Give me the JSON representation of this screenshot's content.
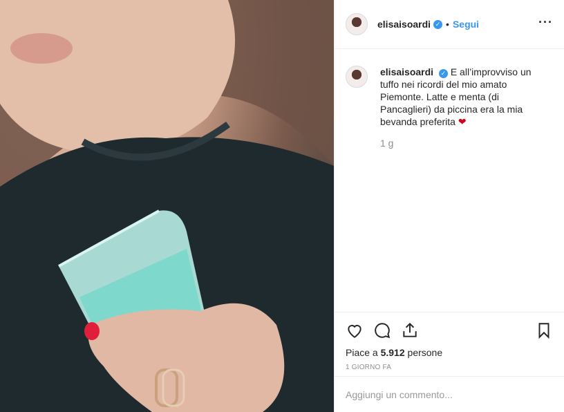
{
  "post": {
    "username": "elisaisoardi",
    "verified_icon": "verified-badge-icon",
    "follow_label": "Segui",
    "more_icon": "more-options-icon"
  },
  "caption": {
    "username": "elisaisoardi",
    "text": "E all’improvviso un tuffo nei ricordi del mio amato Piemonte. Latte e menta (di Pancaglieri) da piccina era la mia bevanda preferita",
    "emoji": "❤",
    "age": "1 g"
  },
  "actions": {
    "like_icon": "heart-icon",
    "comment_icon": "comment-icon",
    "share_icon": "share-icon",
    "save_icon": "bookmark-icon"
  },
  "likes": {
    "prefix": "Piace a ",
    "count": "5.912",
    "suffix": " persone"
  },
  "timestamp": "1 GIORNO FA",
  "comment_box": {
    "placeholder": "Aggiungi un commento..."
  },
  "colors": {
    "accent": "#3897f0",
    "heart": "#d0021b"
  }
}
